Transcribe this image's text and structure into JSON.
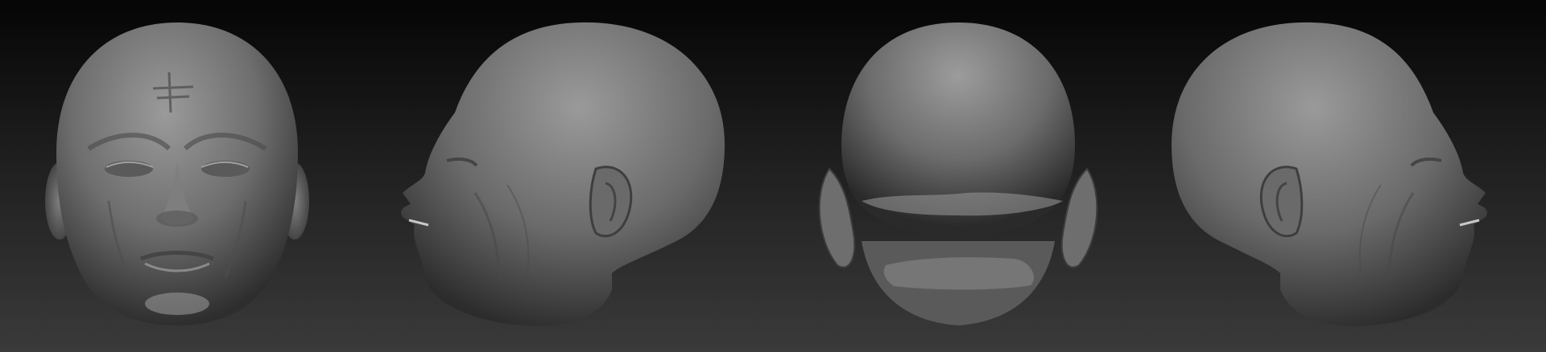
{
  "scene": {
    "background_top": "#050505",
    "background_bottom": "#3a3a3a",
    "material_color": "#7a7a7a",
    "views": [
      {
        "id": "front",
        "icon": "head-front-icon"
      },
      {
        "id": "left-profile",
        "icon": "head-profile-left-icon"
      },
      {
        "id": "back",
        "icon": "head-back-icon"
      },
      {
        "id": "right-profile",
        "icon": "head-profile-right-icon"
      }
    ]
  }
}
